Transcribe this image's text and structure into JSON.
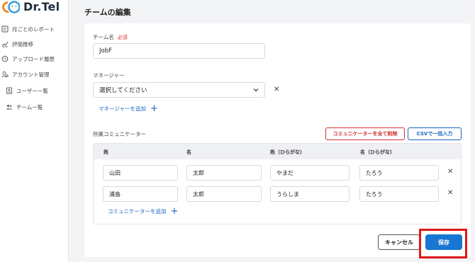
{
  "app": {
    "logo_text": "Dr.Tel"
  },
  "sidebar": {
    "items": [
      {
        "label": "月ごとのレポート",
        "icon": "report-icon"
      },
      {
        "label": "評価推移",
        "icon": "trend-icon"
      },
      {
        "label": "アップロード履歴",
        "icon": "history-icon"
      },
      {
        "label": "アカウント管理",
        "icon": "account-icon"
      },
      {
        "label": "ユーザー一覧",
        "icon": "user-list-icon"
      },
      {
        "label": "チーム一覧",
        "icon": "team-list-icon"
      }
    ]
  },
  "page": {
    "title": "チームの編集"
  },
  "form": {
    "team_name_label": "チーム名",
    "required_label": "必須",
    "team_name_value": "JobF",
    "manager_label": "マネージャー",
    "manager_select_value": "選択してください",
    "add_manager_label": "マネージャーを追加",
    "communicators_label": "所属コミュニケーター",
    "delete_all_label": "コミュニケーターを全て削除",
    "csv_import_label": "CSVで一括入力",
    "table": {
      "headers": [
        "姓",
        "名",
        "姓（ひらがな）",
        "名（ひらがな）"
      ],
      "rows": [
        [
          "山田",
          "太郎",
          "やまだ",
          "たろう"
        ],
        [
          "浦島",
          "太郎",
          "うらしま",
          "たろう"
        ]
      ]
    },
    "add_communicator_label": "コミュニケーターを追加",
    "cancel_label": "キャンセル",
    "save_label": "保存"
  },
  "colors": {
    "accent": "#1976d2",
    "danger": "#d32f2f",
    "highlight": "#e01818"
  }
}
